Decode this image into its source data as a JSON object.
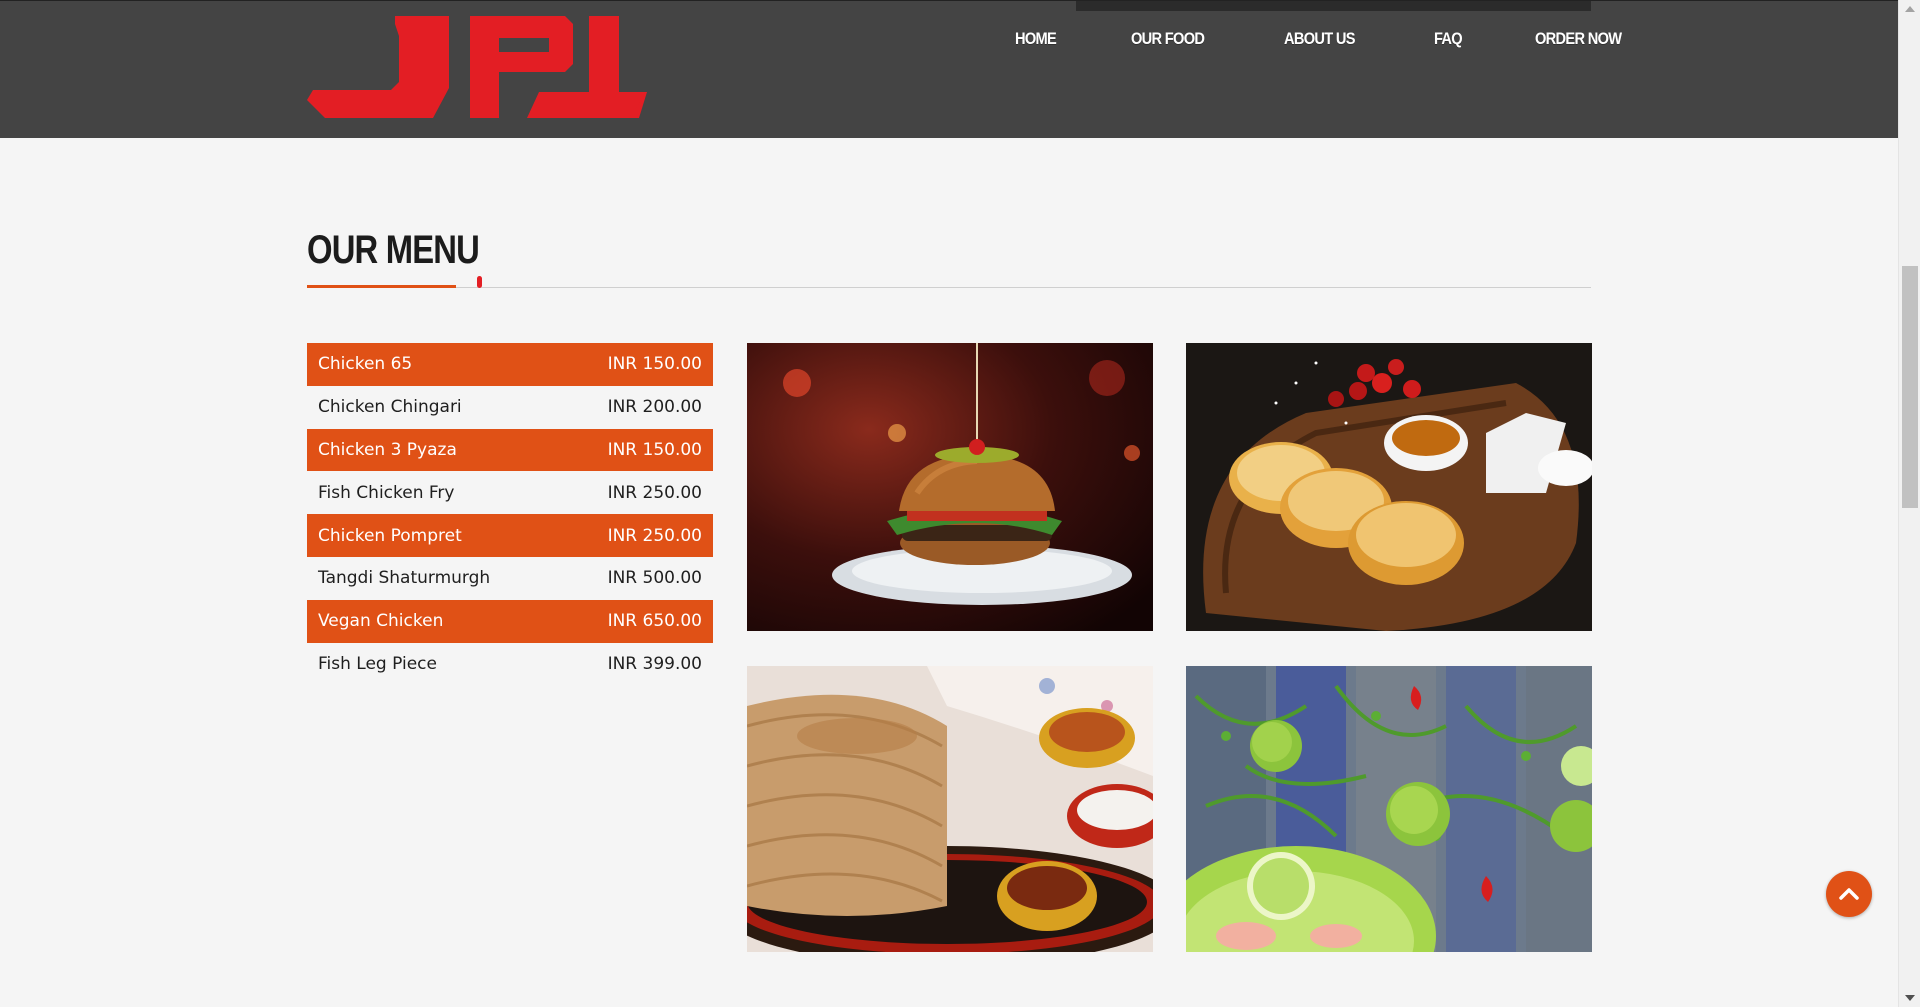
{
  "brand": {
    "logo_text": "JPL",
    "logo_color": "#e31e24"
  },
  "nav": {
    "items": [
      {
        "label": "HOME"
      },
      {
        "label": "OUR FOOD"
      },
      {
        "label": "ABOUT US"
      },
      {
        "label": "FAQ"
      },
      {
        "label": "ORDER NOW"
      }
    ]
  },
  "menu_section": {
    "title": "OUR MENU",
    "accent_color": "#e05116",
    "items": [
      {
        "name": "Chicken 65",
        "price": "INR 150.00",
        "highlighted": true
      },
      {
        "name": "Chicken Chingari",
        "price": "INR 200.00",
        "highlighted": false
      },
      {
        "name": "Chicken 3 Pyaza",
        "price": "INR 150.00",
        "highlighted": true
      },
      {
        "name": "Fish Chicken Fry",
        "price": "INR 250.00",
        "highlighted": false
      },
      {
        "name": "Chicken Pompret",
        "price": "INR 250.00",
        "highlighted": true
      },
      {
        "name": "Tangdi Shaturmurgh",
        "price": "INR 500.00",
        "highlighted": false
      },
      {
        "name": "Vegan Chicken",
        "price": "INR 650.00",
        "highlighted": true
      },
      {
        "name": "Fish Leg Piece",
        "price": "INR 399.00",
        "highlighted": false
      }
    ],
    "gallery": [
      {
        "subject": "burger"
      },
      {
        "subject": "pancakes-with-berries"
      },
      {
        "subject": "crepes-stack"
      },
      {
        "subject": "limes-and-herbs"
      }
    ]
  },
  "back_to_top": {
    "icon": "chevron-up-icon"
  }
}
